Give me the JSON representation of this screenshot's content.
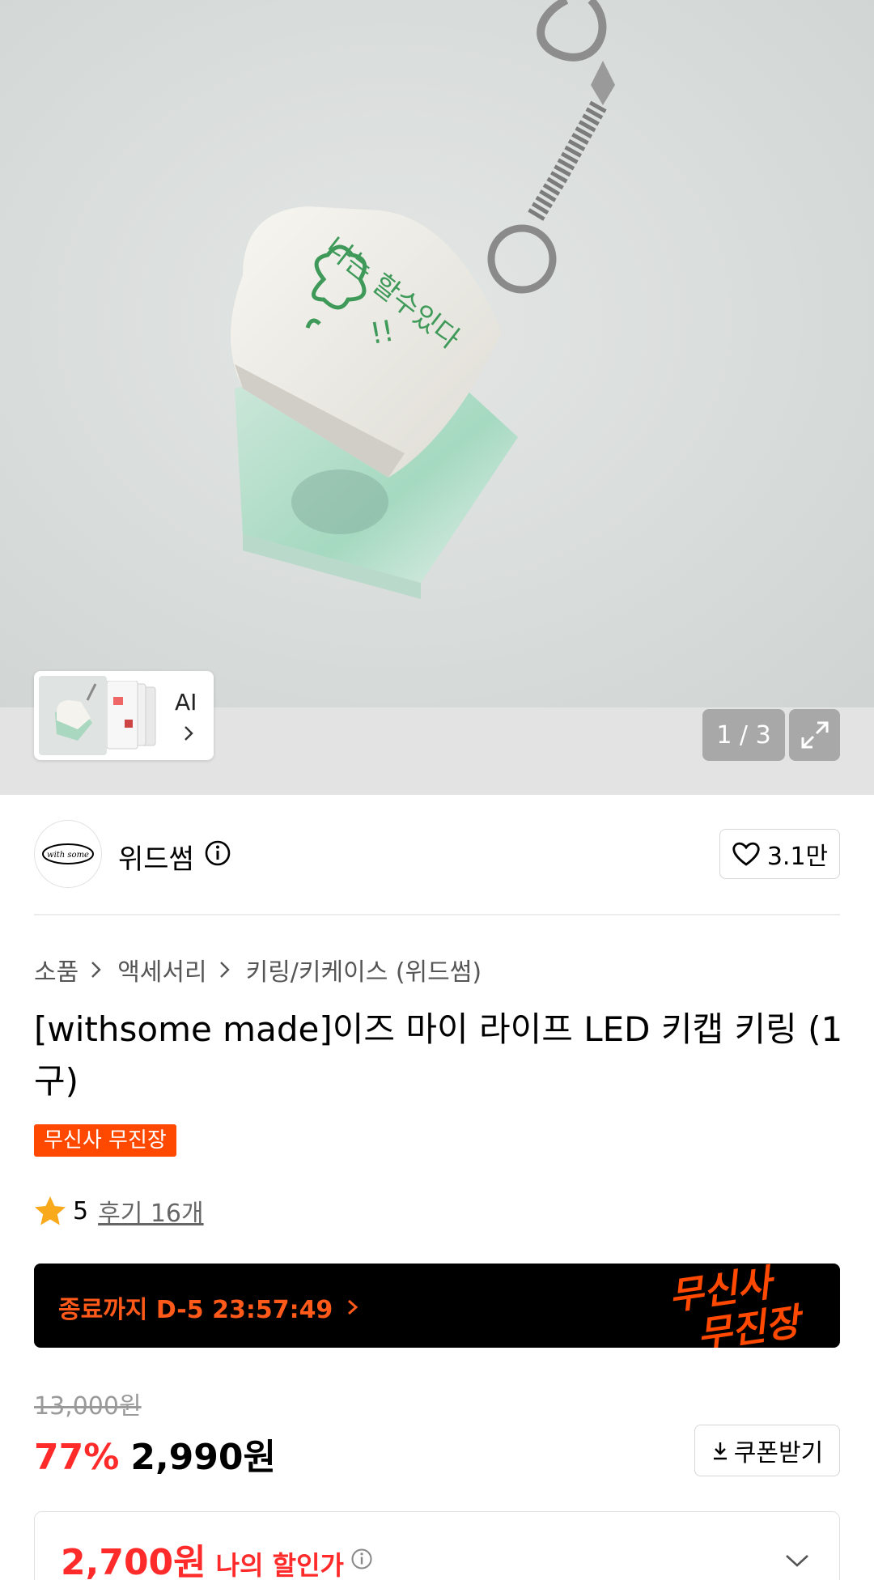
{
  "gallery": {
    "thumbnail_ai_label": "AI",
    "counter": "1 / 3"
  },
  "store": {
    "logo_text": "with some",
    "name": "위드썸",
    "likes": "3.1만"
  },
  "breadcrumb": [
    "소품",
    "액세서리",
    "키링/키케이스 (위드썸)"
  ],
  "product": {
    "title": "[withsome made]이즈 마이 라이프 LED 키캡 키링 (1구)",
    "badge": "무신사 무진장",
    "rating": "5",
    "review_link": "후기 16개"
  },
  "timer_banner": {
    "text": "종료까지 D-5 23:57:49",
    "logo_line1": "무신사",
    "logo_line2": "무진장"
  },
  "pricing": {
    "original": "13,000원",
    "discount": "77%",
    "price": "2,990원",
    "coupon_label": "쿠폰받기",
    "my_price": "2,700원",
    "my_price_label": "나의 할인가"
  },
  "colors": {
    "accent_orange": "#ff4800",
    "discount_red": "#ff2a2a"
  },
  "icons": [
    "chevron-right-icon",
    "expand-icon",
    "info-icon",
    "heart-icon",
    "star-icon",
    "download-icon",
    "chevron-down-icon"
  ]
}
